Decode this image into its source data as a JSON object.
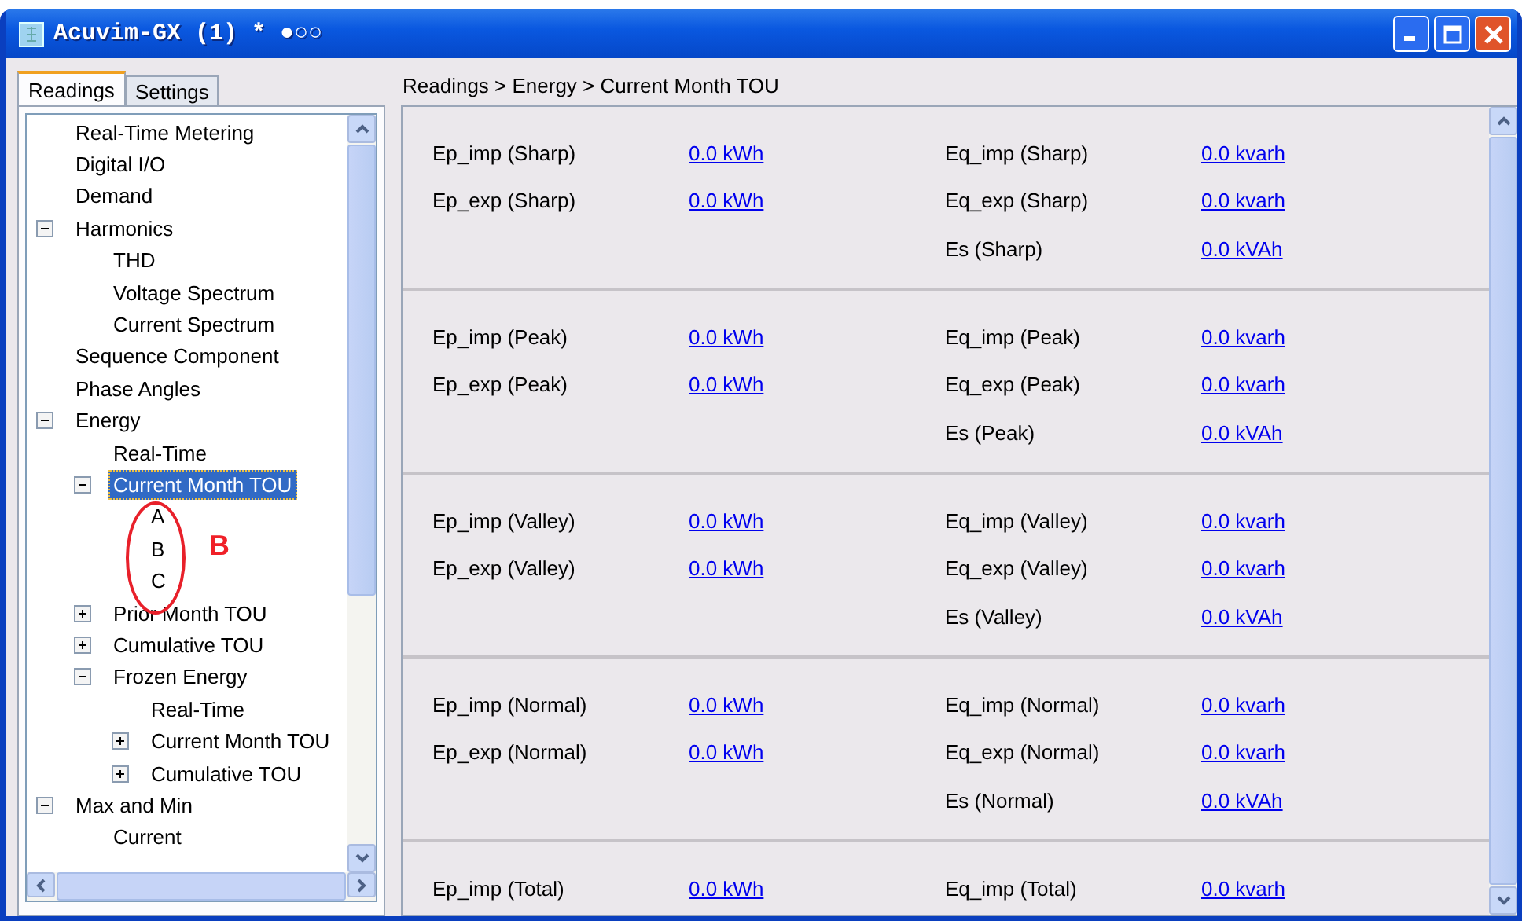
{
  "window": {
    "title": "Acuvim-GX (1) * ●○○"
  },
  "tabs": [
    {
      "label": "Readings",
      "selected": true
    },
    {
      "label": "Settings",
      "selected": false
    }
  ],
  "tree": [
    {
      "label": "Real-Time Metering",
      "selected": false
    },
    {
      "label": "Digital I/O",
      "selected": false
    },
    {
      "label": "Demand",
      "selected": false
    },
    {
      "label": "Harmonics",
      "selected": false,
      "expanded": true,
      "children": [
        {
          "label": "THD",
          "selected": false
        },
        {
          "label": "Voltage Spectrum",
          "selected": false
        },
        {
          "label": "Current Spectrum",
          "selected": false
        }
      ]
    },
    {
      "label": "Sequence Component",
      "selected": false
    },
    {
      "label": "Phase Angles",
      "selected": false
    },
    {
      "label": "Energy",
      "selected": false,
      "expanded": true,
      "children": [
        {
          "label": "Real-Time",
          "selected": false
        },
        {
          "label": "Current Month TOU",
          "selected": true,
          "expanded": true,
          "children": [
            {
              "label": "A",
              "selected": false
            },
            {
              "label": "B",
              "selected": false
            },
            {
              "label": "C",
              "selected": false
            }
          ]
        },
        {
          "label": "Prior Month TOU",
          "selected": false,
          "expanded": false
        },
        {
          "label": "Cumulative TOU",
          "selected": false,
          "expanded": false
        },
        {
          "label": "Frozen Energy",
          "selected": false,
          "expanded": true,
          "children": [
            {
              "label": "Real-Time",
              "selected": false
            },
            {
              "label": "Current Month TOU",
              "selected": false,
              "expanded": false
            },
            {
              "label": "Cumulative TOU",
              "selected": false,
              "expanded": false
            }
          ]
        }
      ]
    },
    {
      "label": "Max and Min",
      "selected": false,
      "expanded": true,
      "children": [
        {
          "label": "Current",
          "selected": false
        }
      ]
    }
  ],
  "annotation": {
    "label": "B"
  },
  "breadcrumb": "Readings > Energy > Current Month TOU",
  "sections": [
    {
      "rows": [
        [
          "Ep_imp (Sharp)",
          "0.0 kWh",
          "Eq_imp (Sharp)",
          "0.0 kvarh"
        ],
        [
          "Ep_exp (Sharp)",
          "0.0 kWh",
          "Eq_exp (Sharp)",
          "0.0 kvarh"
        ],
        [
          "",
          "",
          "Es (Sharp)",
          "0.0 kVAh"
        ]
      ]
    },
    {
      "rows": [
        [
          "Ep_imp (Peak)",
          "0.0 kWh",
          "Eq_imp (Peak)",
          "0.0 kvarh"
        ],
        [
          "Ep_exp (Peak)",
          "0.0 kWh",
          "Eq_exp (Peak)",
          "0.0 kvarh"
        ],
        [
          "",
          "",
          "Es (Peak)",
          "0.0 kVAh"
        ]
      ]
    },
    {
      "rows": [
        [
          "Ep_imp (Valley)",
          "0.0 kWh",
          "Eq_imp (Valley)",
          "0.0 kvarh"
        ],
        [
          "Ep_exp (Valley)",
          "0.0 kWh",
          "Eq_exp (Valley)",
          "0.0 kvarh"
        ],
        [
          "",
          "",
          "Es (Valley)",
          "0.0 kVAh"
        ]
      ]
    },
    {
      "rows": [
        [
          "Ep_imp (Normal)",
          "0.0 kWh",
          "Eq_imp (Normal)",
          "0.0 kvarh"
        ],
        [
          "Ep_exp (Normal)",
          "0.0 kWh",
          "Eq_exp (Normal)",
          "0.0 kvarh"
        ],
        [
          "",
          "",
          "Es (Normal)",
          "0.0 kVAh"
        ]
      ]
    },
    {
      "rows": [
        [
          "Ep_imp (Total)",
          "0.0 kWh",
          "Eq_imp (Total)",
          "0.0 kvarh"
        ]
      ]
    }
  ]
}
